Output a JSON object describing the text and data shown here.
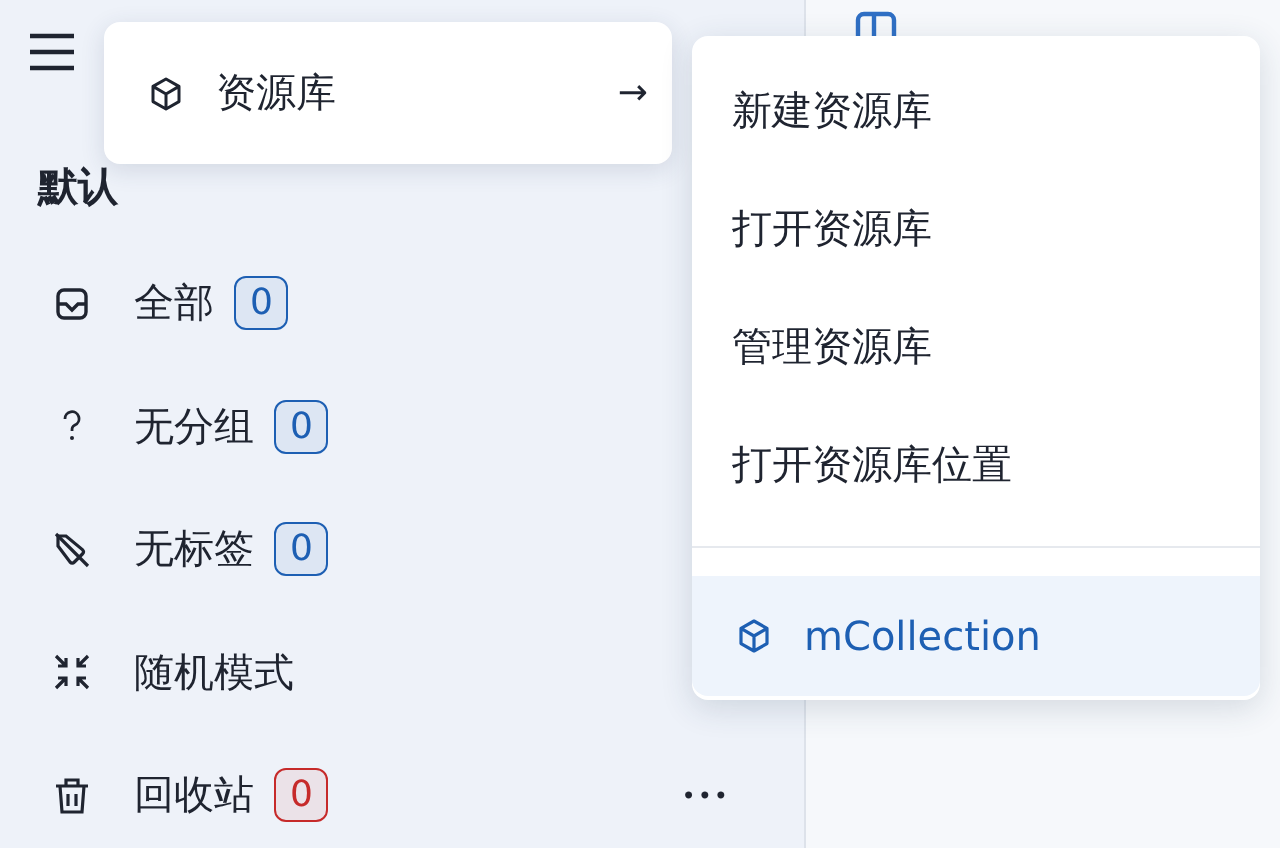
{
  "sidebar": {
    "section_title": "默认",
    "items": [
      {
        "label": "全部",
        "badge": {
          "text": "0",
          "color": "#1d5fb3"
        }
      },
      {
        "label": "无分组",
        "badge": {
          "text": "0",
          "color": "#1d5fb3"
        }
      },
      {
        "label": "无标签",
        "badge": {
          "text": "0",
          "color": "#1d5fb3"
        }
      },
      {
        "label": "随机模式"
      },
      {
        "label": "回收站",
        "badge": {
          "text": "0",
          "color": "#c62a2a"
        },
        "more": "•••"
      }
    ]
  },
  "library_menu": {
    "label": "资源库",
    "arrow": "→"
  },
  "submenu": {
    "items": [
      {
        "label": "新建资源库",
        "selected": false
      },
      {
        "label": "打开资源库",
        "selected": false
      },
      {
        "label": "管理资源库",
        "selected": false
      },
      {
        "label": "打开资源库位置",
        "selected": false
      }
    ],
    "libraries": [
      {
        "label": "mCollection",
        "selected": true
      }
    ]
  }
}
